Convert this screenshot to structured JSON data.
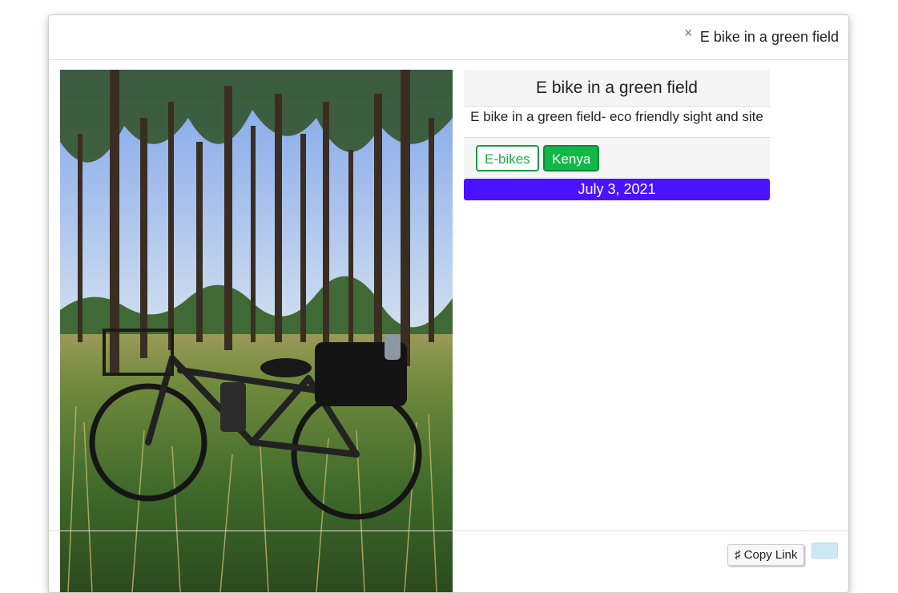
{
  "header": {
    "close_symbol": "×",
    "title": "E bike in a green field"
  },
  "post": {
    "title": "E bike in a green field",
    "description": "E bike in a green field- eco friendly sight and site",
    "tags": [
      "E-bikes",
      "Kenya"
    ],
    "date": "July 3, 2021"
  },
  "footer": {
    "copy_icon": "♯",
    "copy_label": "Copy Link"
  },
  "colors": {
    "date_bar": "#4a12ff",
    "tag_green": "#12b847",
    "extra_button": "#cfe9f3"
  },
  "icons": {
    "close": "close-icon",
    "copy": "hash-icon"
  }
}
